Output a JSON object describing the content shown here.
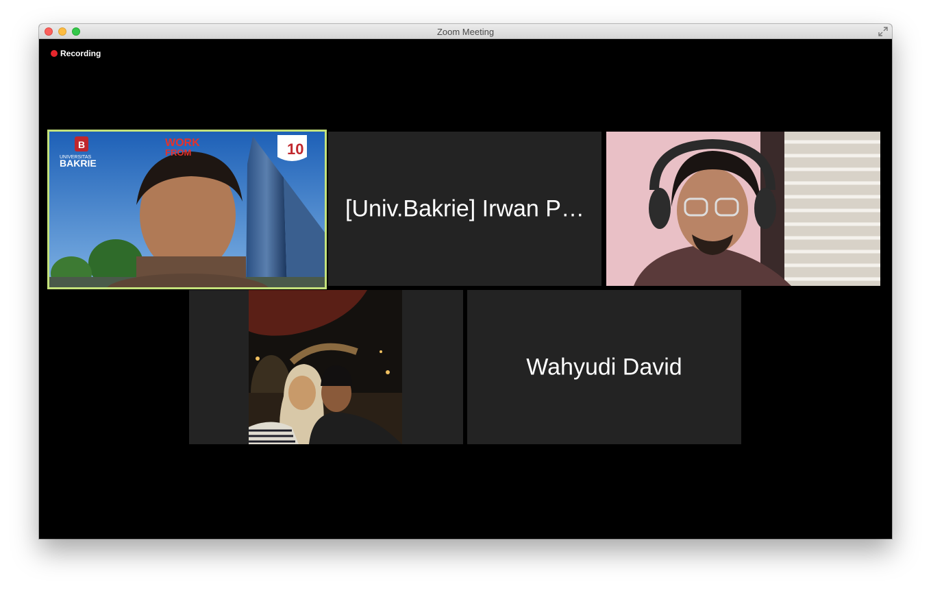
{
  "window": {
    "title": "Zoom Meeting",
    "colors": {
      "background": "#000000",
      "tile": "#232323",
      "active_speaker_border": "#c4e27b",
      "recording_dot": "#e5262c"
    }
  },
  "recording": {
    "label": "Recording",
    "icon": "recording-dot-icon"
  },
  "participants": [
    {
      "name_label": "",
      "video_on": true,
      "active_speaker": true,
      "video_logo_text": {
        "university_small": "UNIVERSITAS",
        "university_big": "BAKRIE",
        "badge": "B",
        "work_text": "WORK",
        "from_text": "FROM",
        "anniversary": "10"
      }
    },
    {
      "name_label": "[Univ.Bakrie] Irwan P…",
      "video_on": false,
      "active_speaker": false
    },
    {
      "name_label": "",
      "video_on": true,
      "active_speaker": false
    },
    {
      "name_label": "",
      "video_on": true,
      "active_speaker": false
    },
    {
      "name_label": "Wahyudi David",
      "video_on": false,
      "active_speaker": false
    }
  ]
}
